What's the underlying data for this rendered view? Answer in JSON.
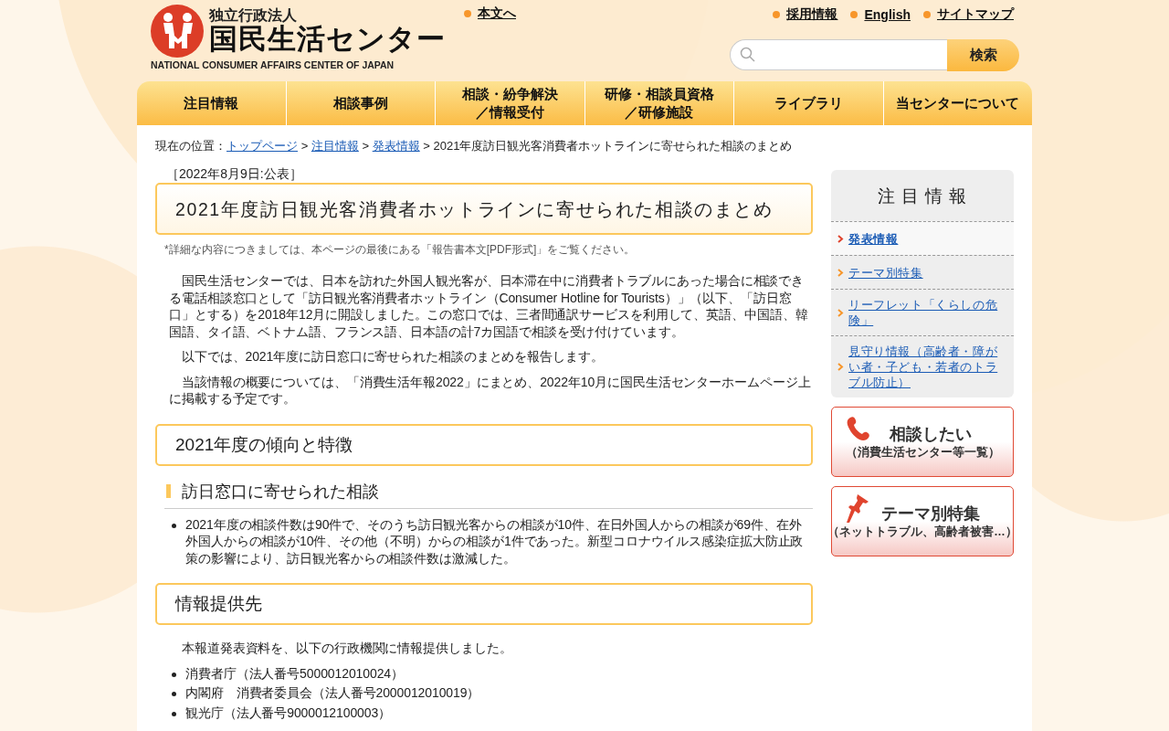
{
  "header": {
    "logo": {
      "org_type": "独立行政法人",
      "name": "国民生活センター",
      "english": "NATIONAL CONSUMER AFFAIRS CENTER OF JAPAN"
    },
    "skip_link": "本文へ",
    "utility_links": [
      "採用情報",
      "English",
      "サイトマップ"
    ],
    "search": {
      "button": "検索"
    }
  },
  "nav": [
    {
      "lines": [
        "注目情報"
      ]
    },
    {
      "lines": [
        "相談事例"
      ]
    },
    {
      "lines": [
        "相談・紛争解決",
        "／情報受付"
      ]
    },
    {
      "lines": [
        "研修・相談員資格",
        "／研修施設"
      ]
    },
    {
      "lines": [
        "ライブラリ"
      ]
    },
    {
      "lines": [
        "当センターについて"
      ]
    }
  ],
  "breadcrumb": {
    "label": "現在の位置：",
    "separator": ">",
    "links": [
      "トップページ",
      "注目情報",
      "発表情報"
    ],
    "current": "2021年度訪日観光客消費者ホットラインに寄せられた相談のまとめ"
  },
  "article": [
    {
      "kind": "date",
      "text": "［2022年8月9日:公表］"
    },
    {
      "kind": "title",
      "text": "2021年度訪日観光客消費者ホットラインに寄せられた相談のまとめ"
    },
    {
      "kind": "note",
      "text": "*詳細な内容につきましては、本ページの最後にある「報告書本文[PDF形式]」をご覧ください。"
    },
    {
      "kind": "paragraph",
      "text": "国民生活センターでは、日本を訪れた外国人観光客が、日本滞在中に消費者トラブルにあった場合に相談できる電話相談窓口として「訪日観光客消費者ホットライン（Consumer Hotline for Tourists）」（以下、「訪日窓口」とする）を2018年12月に開設しました。この窓口では、三者間通訳サービスを利用して、英語、中国語、韓国語、タイ語、ベトナム語、フランス語、日本語の計7カ国語で相談を受け付けています。"
    },
    {
      "kind": "paragraph",
      "text": "以下では、2021年度に訪日窓口に寄せられた相談のまとめを報告します。"
    },
    {
      "kind": "paragraph",
      "text": "当該情報の概要については、「消費生活年報2022」にまとめ、2022年10月に国民生活センターホームページ上に掲載する予定です。"
    },
    {
      "kind": "section",
      "text": "2021年度の傾向と特徴"
    },
    {
      "kind": "subsection",
      "text": "訪日窓口に寄せられた相談"
    },
    {
      "kind": "bullets",
      "items": [
        "2021年度の相談件数は90件で、そのうち訪日観光客からの相談が10件、在日外国人からの相談が69件、在外外国人からの相談が10件、その他（不明）からの相談が1件であった。新型コロナウイルス感染症拡大防止政策の影響により、訪日観光客からの相談件数は激減した。"
      ]
    },
    {
      "kind": "section",
      "text": "情報提供先"
    },
    {
      "kind": "paragraph",
      "text": "本報道発表資料を、以下の行政機関に情報提供しました。"
    },
    {
      "kind": "bullets",
      "items": [
        "消費者庁（法人番号5000012010024）",
        "内閣府　消費者委員会（法人番号2000012010019）",
        "観光庁（法人番号9000012100003）"
      ]
    }
  ],
  "sidebar": {
    "title": "注 目 情 報",
    "items": [
      {
        "label": "発表情報",
        "selected": true
      },
      {
        "label": "テーマ別特集",
        "selected": false
      },
      {
        "label": "リーフレット「くらしの危険」",
        "selected": false
      },
      {
        "label": "見守り情報（高齢者・障がい者・子ども・若者のトラブル防止）",
        "selected": false
      }
    ],
    "banners": [
      {
        "kind": "phone",
        "title": "相談したい",
        "subtitle": "（消費生活センター等一覧）"
      },
      {
        "kind": "pin",
        "title": "テーマ別特集",
        "subtitle": "（ネットトラブル、高齢者被害…）"
      }
    ]
  }
}
